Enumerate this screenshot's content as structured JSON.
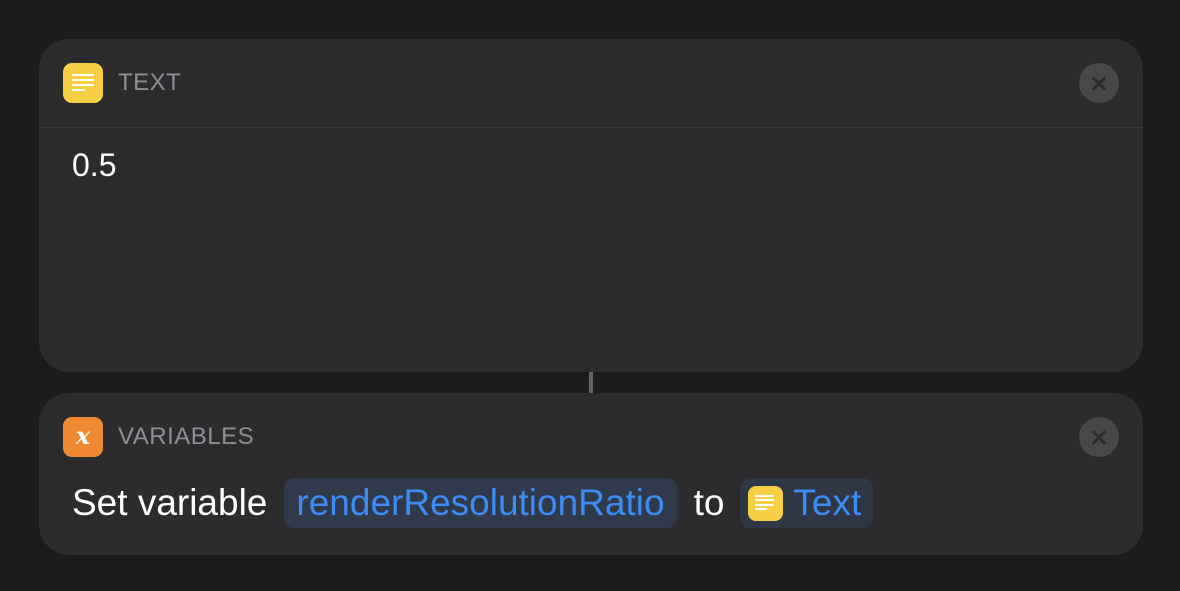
{
  "text_action": {
    "category": "TEXT",
    "icon": "text-lines-icon",
    "value": "0.5",
    "close_icon": "close-icon"
  },
  "variables_action": {
    "category": "VARIABLES",
    "icon": "variable-x-icon",
    "icon_glyph": "x",
    "prefix": "Set variable",
    "variable_name": "renderResolutionRatio",
    "connector_word": "to",
    "input_label": "Text",
    "input_icon": "text-lines-icon",
    "close_icon": "close-icon"
  },
  "colors": {
    "background": "#1c1c1e",
    "card": "#2c2c2e",
    "text_icon": "#f7cf45",
    "variables_icon": "#f08a32",
    "token_text": "#3d8bf5",
    "category_text": "#8e8e93"
  }
}
